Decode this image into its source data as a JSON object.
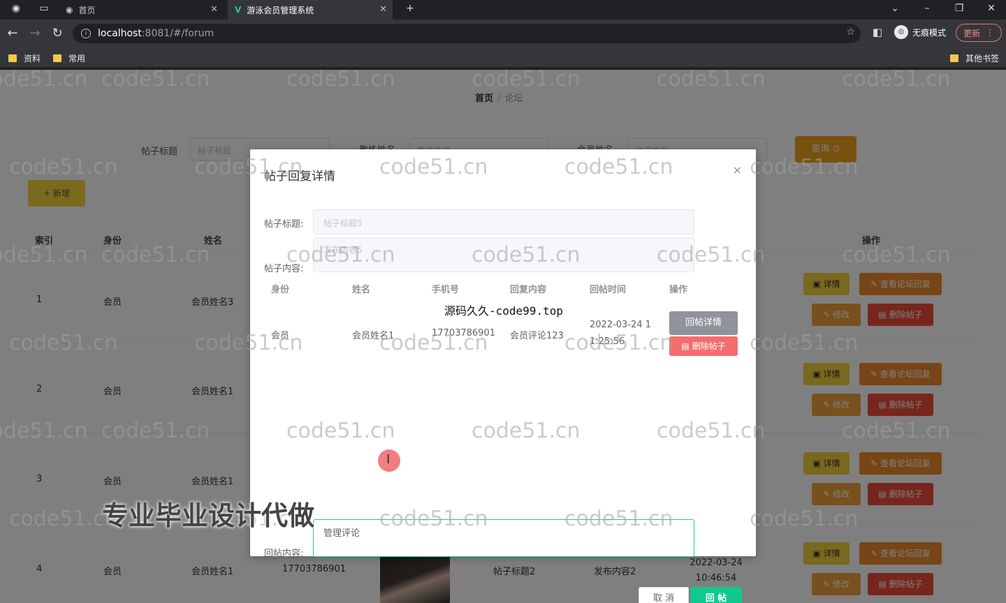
{
  "browser": {
    "tabs": [
      {
        "title": "首页"
      },
      {
        "title": "游泳会员管理系统"
      }
    ],
    "url_host": "localhost",
    "url_path": ":8081/#/forum",
    "incognito_label": "无痕模式",
    "update_label": "更新",
    "bookmarks": [
      "资料",
      "常用"
    ],
    "other_bookmarks": "其他书签"
  },
  "page": {
    "breadcrumb": {
      "home": "首页",
      "separator": "/",
      "current": "论坛"
    },
    "search": {
      "title_label": "帖子标题",
      "title_placeholder": "帖子标题",
      "coach_label": "教练姓名",
      "coach_placeholder": "教练姓名",
      "member_label": "会员姓名",
      "member_placeholder": "会员姓名",
      "query_button": "查询 ⊙"
    },
    "add_button": "+ 新增",
    "table_headers": {
      "index": "索引",
      "role": "身份",
      "name": "姓名",
      "ops": "操作"
    },
    "rows": [
      {
        "index": "1",
        "role": "会员",
        "name": "会员姓名3"
      },
      {
        "index": "2",
        "role": "会员",
        "name": "会员姓名1"
      },
      {
        "index": "3",
        "role": "会员",
        "name": "会员姓名1"
      },
      {
        "index": "4",
        "role": "会员",
        "name": "会员姓名1",
        "phone": "17703786901",
        "title": "帖子标题2",
        "content": "发布内容2",
        "time": "2022-03-24 10:46:54"
      }
    ],
    "ops": {
      "detail": "详情",
      "view_reply": "查看论坛回复",
      "edit": "修改",
      "delete": "删除帖子"
    }
  },
  "dialog": {
    "title": "帖子回复详情",
    "close": "×",
    "post_title_label": "帖子标题:",
    "post_title_value": "帖子标题5",
    "post_content_label": "帖子内容:",
    "post_content_value": "发布内容5",
    "table_headers": {
      "role": "身份",
      "name": "姓名",
      "phone": "手机号",
      "reply": "回复内容",
      "time": "回帖时间",
      "ops": "操作"
    },
    "reply_row": {
      "role": "会员",
      "name": "会员姓名1",
      "phone": "17703786901",
      "reply": "会员评论123",
      "time_line1": "2022-03-24 1",
      "time_line2": "1:25:56"
    },
    "reply_detail_button": "回帖详情",
    "reply_delete_button": "删除帖子",
    "reply_content_label": "回帖内容:",
    "reply_content_value": "管理评论",
    "cancel_button": "取 消",
    "submit_button": "回 帖"
  },
  "overlays": {
    "watermark": "code51.cn",
    "center_text": "源码久久-code99.top",
    "promo_text": "专业毕业设计代做"
  }
}
